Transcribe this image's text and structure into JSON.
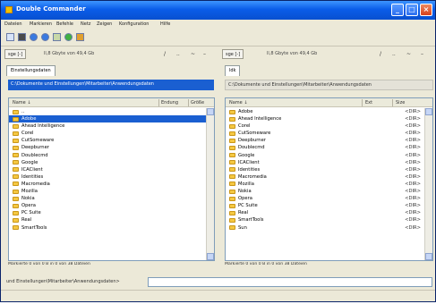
{
  "app": {
    "title": "Double Commander"
  },
  "menu": [
    "Dateien",
    "Markieren",
    "Befehle",
    "Netz",
    "Zeigen",
    "Konfiguration",
    "Hilfe"
  ],
  "left_panel": {
    "drive": "sge [-]",
    "drive_info": "ll,8 Gbyte von 49,4 Gb",
    "tab": "Einstellungsdaten",
    "path": "C:\\Dokumente und Einstellungen\\Mitarbeiter\\Anwendungsdaten",
    "columns": {
      "name": "Name ↓",
      "ext": "Endung",
      "size": "Größe"
    },
    "rows": [
      {
        "name": "..",
        "size": ""
      },
      {
        "name": "Adobe",
        "size": ""
      },
      {
        "name": "Ahead Intelligence",
        "size": ""
      },
      {
        "name": "Corel",
        "size": ""
      },
      {
        "name": "CutSomeware",
        "size": ""
      },
      {
        "name": "Deepburner",
        "size": ""
      },
      {
        "name": "Doublecmd",
        "size": ""
      },
      {
        "name": "Google",
        "size": ""
      },
      {
        "name": "ICAClient",
        "size": ""
      },
      {
        "name": "Identities",
        "size": ""
      },
      {
        "name": "Macromedia",
        "size": ""
      },
      {
        "name": "Mozilla",
        "size": ""
      },
      {
        "name": "Nokia",
        "size": ""
      },
      {
        "name": "Opera",
        "size": ""
      },
      {
        "name": "PC Suite",
        "size": ""
      },
      {
        "name": "Real",
        "size": ""
      },
      {
        "name": "SmartTools",
        "size": ""
      }
    ],
    "selected_index": 1,
    "status": "Markierte 0 von 0 B in 0 von 38 Dateien"
  },
  "right_panel": {
    "drive": "sge [-]",
    "drive_info": "ll,8 Gbyte von 49,4 Gb",
    "tab": "ldk",
    "path": "C:\\Dokumente und Einstellungen\\Mitarbeiter\\Anwendungsdaten",
    "columns": {
      "name": "Name ↓",
      "ext": "Ext",
      "size": "Size"
    },
    "rows": [
      {
        "name": "Adobe",
        "size": "<DIR>"
      },
      {
        "name": "Ahead Intelligence",
        "size": "<DIR>"
      },
      {
        "name": "Corel",
        "size": "<DIR>"
      },
      {
        "name": "CutSomeware",
        "size": "<DIR>"
      },
      {
        "name": "Deepburner",
        "size": "<DIR>"
      },
      {
        "name": "Doublecmd",
        "size": "<DIR>"
      },
      {
        "name": "Google",
        "size": "<DIR>"
      },
      {
        "name": "ICAClient",
        "size": "<DIR>"
      },
      {
        "name": "Identities",
        "size": "<DIR>"
      },
      {
        "name": "Macromedia",
        "size": "<DIR>"
      },
      {
        "name": "Mozilla",
        "size": "<DIR>"
      },
      {
        "name": "Nokia",
        "size": "<DIR>"
      },
      {
        "name": "Opera",
        "size": "<DIR>"
      },
      {
        "name": "PC Suite",
        "size": "<DIR>"
      },
      {
        "name": "Real",
        "size": "<DIR>"
      },
      {
        "name": "SmartTools",
        "size": "<DIR>"
      },
      {
        "name": "Sun",
        "size": "<DIR>"
      }
    ],
    "status": "Markierte 0 von 0 B in 0 von 38 Dateien"
  },
  "command_line": {
    "label": "und Einstellungen\\Mitarbeiter\\Anwendungsdaten>"
  },
  "colors": {
    "title_bar": "#0a5ce8",
    "selection": "#1a5fd1",
    "folder": "#f5c842"
  }
}
